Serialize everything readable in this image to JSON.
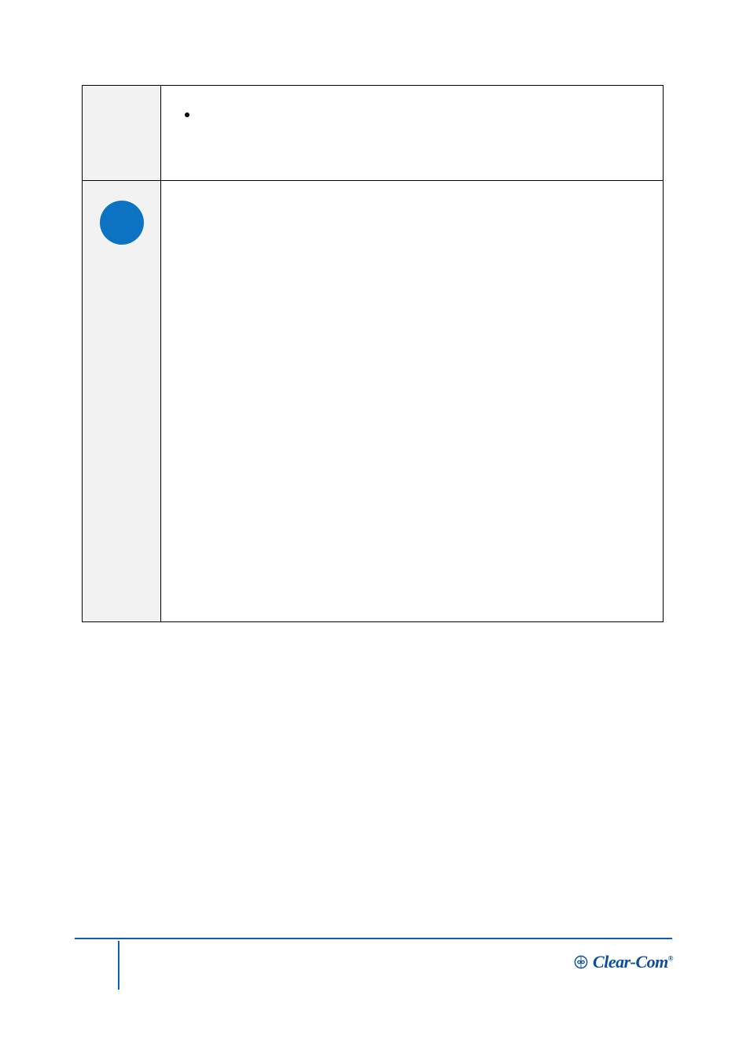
{
  "table": {
    "row1": {
      "bullet_text": ""
    },
    "row2": {
      "text": ""
    }
  },
  "logo": {
    "brand": "Clear-Com",
    "reg": "®",
    "icon_name": "clear-com-logo-icon"
  }
}
